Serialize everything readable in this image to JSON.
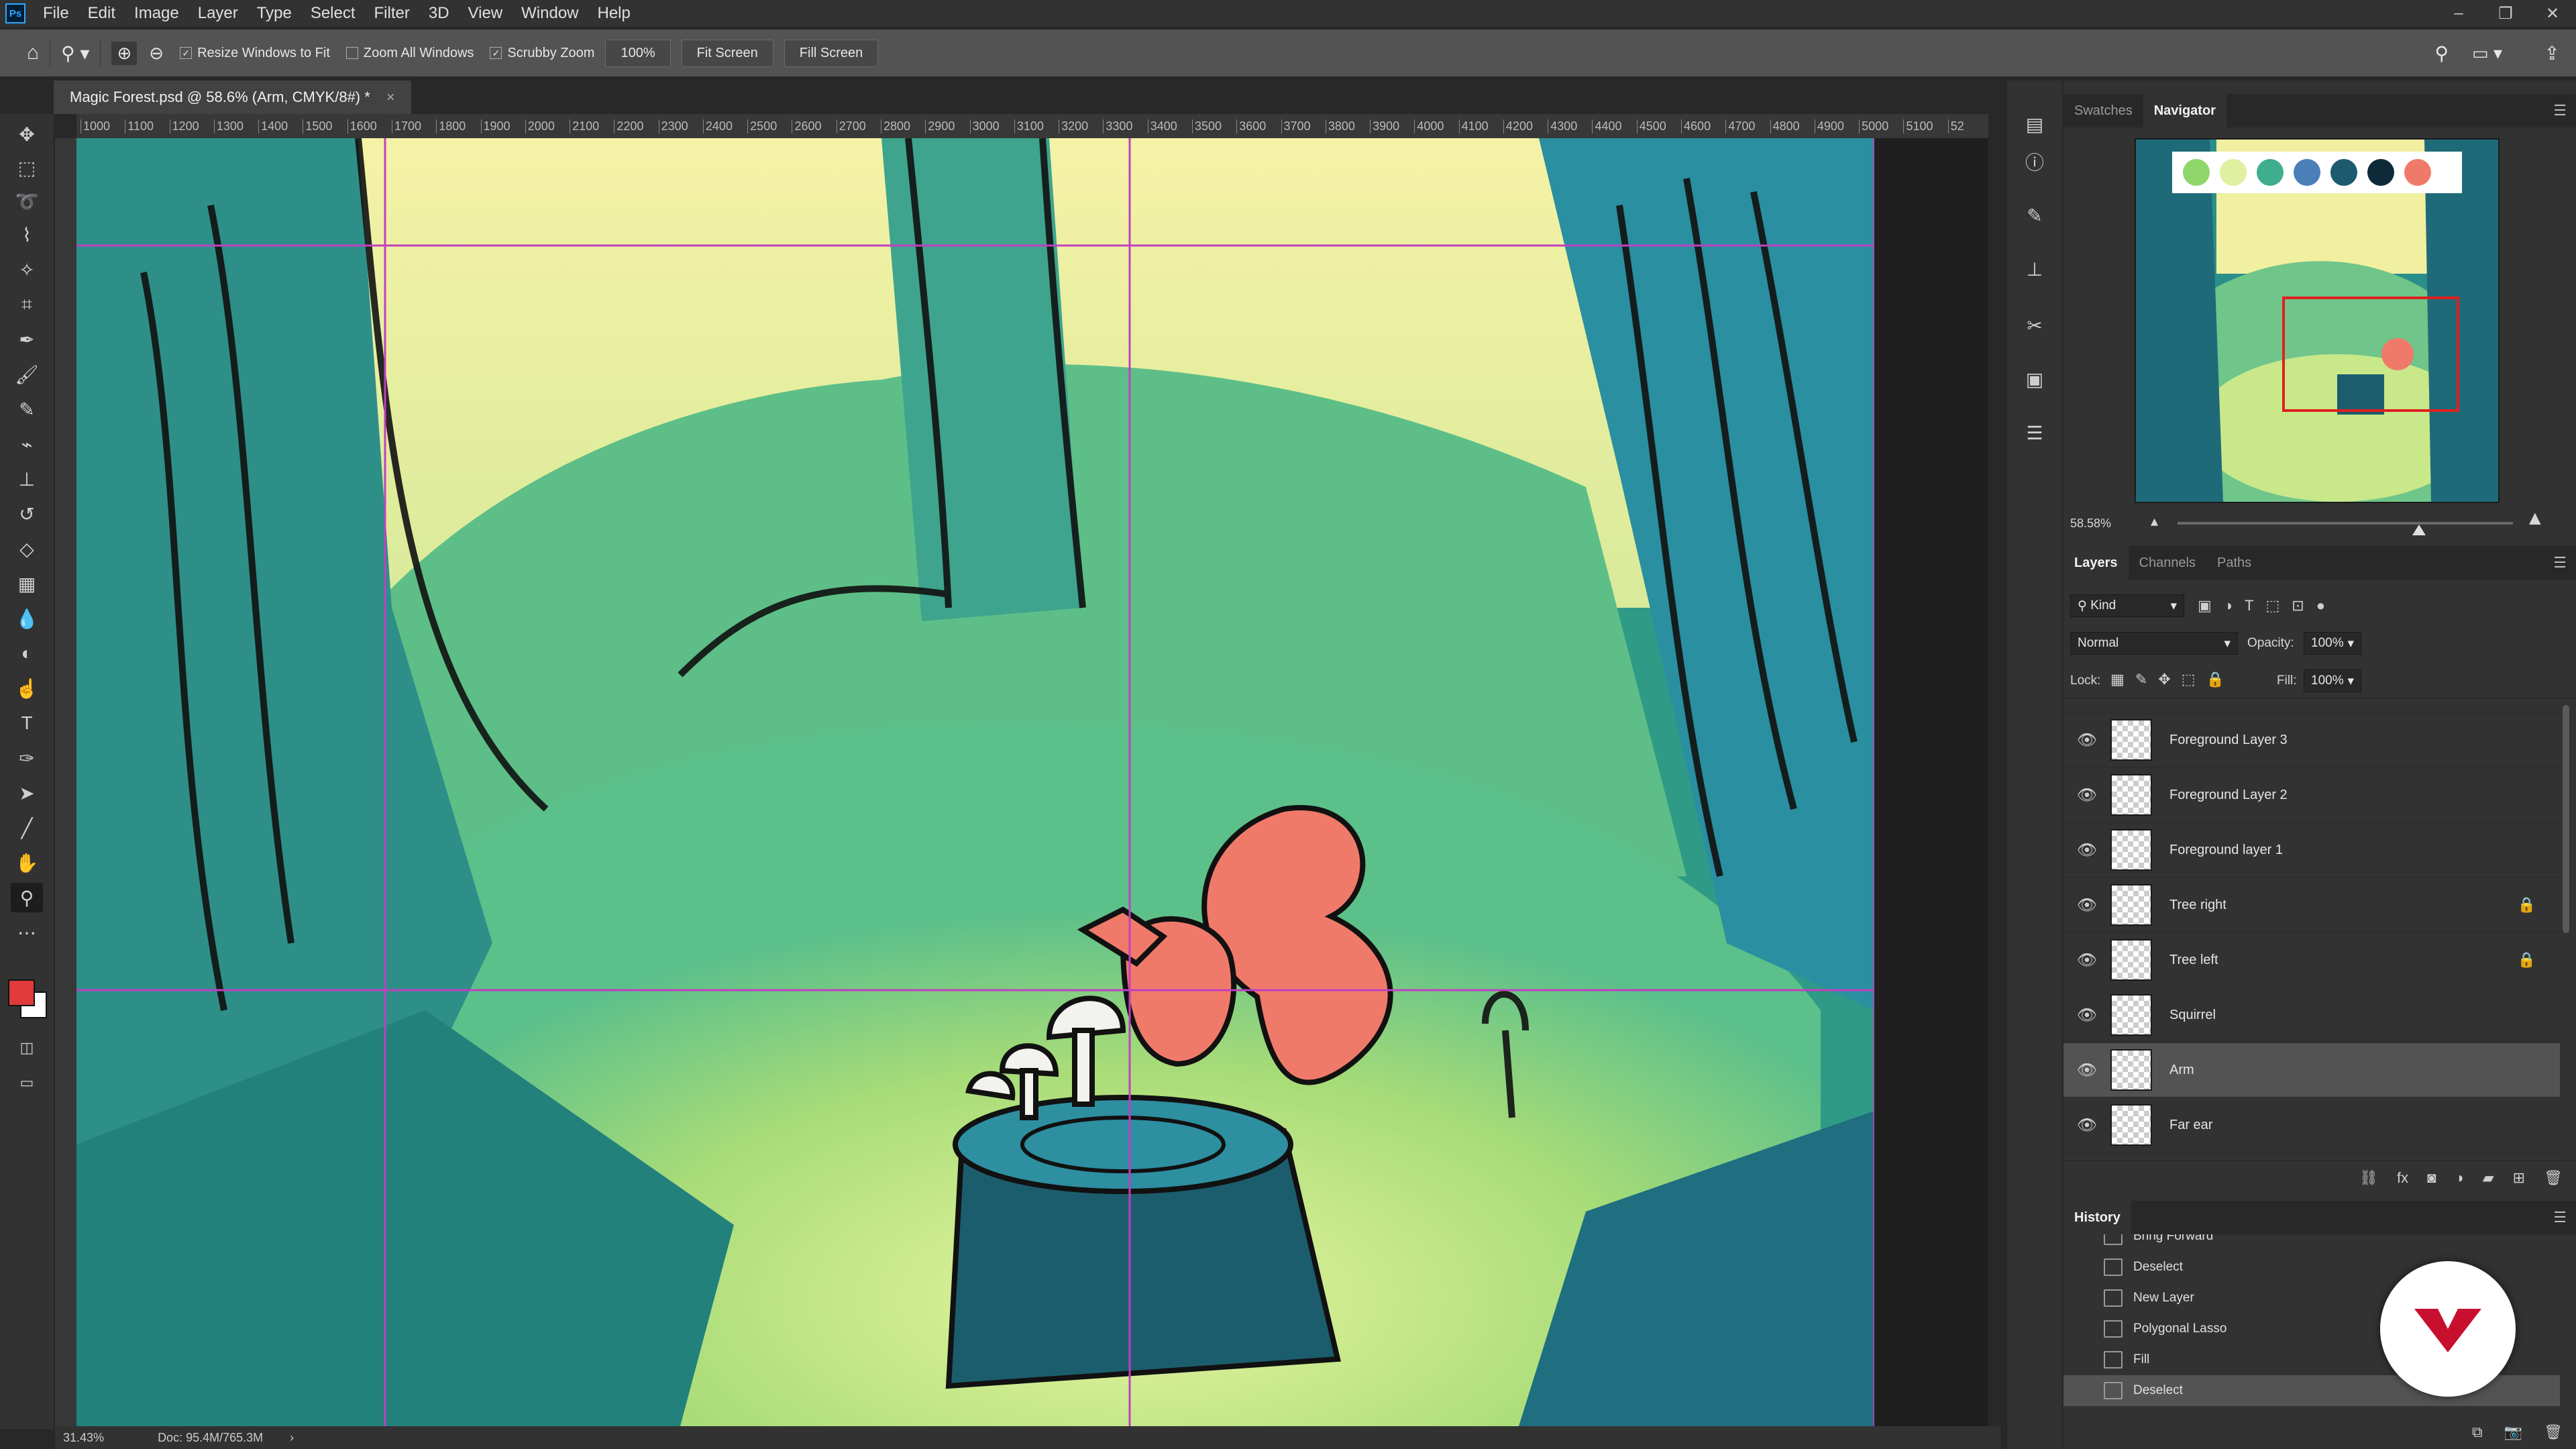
{
  "app": {
    "logo": "Ps"
  },
  "menu": [
    "File",
    "Edit",
    "Image",
    "Layer",
    "Type",
    "Select",
    "Filter",
    "3D",
    "View",
    "Window",
    "Help"
  ],
  "window_controls": [
    "minimize-icon",
    "restore-icon",
    "close-icon"
  ],
  "options": {
    "resize_windows": "Resize Windows to Fit",
    "zoom_all": "Zoom All Windows",
    "scrubby": "Scrubby Zoom",
    "zoom_value": "100%",
    "fit_screen": "Fit Screen",
    "fill_screen": "Fill Screen"
  },
  "document_tab": {
    "title": "Magic Forest.psd @ 58.6% (Arm, CMYK/8#) *",
    "close": "×"
  },
  "ruler_ticks": [
    "1000",
    "1100",
    "1200",
    "1300",
    "1400",
    "1500",
    "1600",
    "1700",
    "1800",
    "1900",
    "2000",
    "2100",
    "2200",
    "2300",
    "2400",
    "2500",
    "2600",
    "2700",
    "2800",
    "2900",
    "3000",
    "3100",
    "3200",
    "3300",
    "3400",
    "3500",
    "3600",
    "3700",
    "3800",
    "3900",
    "4000",
    "4100",
    "4200",
    "4300",
    "4400",
    "4500",
    "4600",
    "4700",
    "4800",
    "4900",
    "5000",
    "5100",
    "52"
  ],
  "tools": [
    "move-tool-icon",
    "marquee-tool-icon",
    "lasso-tool-icon",
    "polygonal-lasso-icon",
    "magic-wand-icon",
    "crop-tool-icon",
    "eyedropper-icon",
    "brush-tool-icon",
    "pencil-tool-icon",
    "mixer-brush-icon",
    "clone-stamp-icon",
    "history-brush-icon",
    "eraser-icon",
    "gradient-tool-icon",
    "blur-tool-icon",
    "dodge-tool-icon",
    "smudge-tool-icon",
    "type-tool-icon",
    "pen-tool-icon",
    "path-select-icon",
    "line-tool-icon",
    "hand-tool-icon",
    "zoom-tool-icon",
    "more-tools-icon"
  ],
  "colors": {
    "foreground": "#e03a3a",
    "background": "#ffffff",
    "accent": "#31a8ff",
    "badge": "#c8102e"
  },
  "navigator": {
    "tabs": [
      "Swatches",
      "Navigator"
    ],
    "active": "Navigator",
    "zoom": "58.58%",
    "swatches": [
      "#8fd66a",
      "#dff0a0",
      "#3fae8e",
      "#4a7fb8",
      "#1e5a6e",
      "#0e2a38",
      "#f07a6a"
    ],
    "zoom_level": 0.72
  },
  "layers_panel": {
    "tabs": [
      "Layers",
      "Channels",
      "Paths"
    ],
    "filter": "Kind",
    "blend_mode": "Normal",
    "opacity_label": "Opacity:",
    "opacity": "100%",
    "lock_label": "Lock:",
    "fill_label": "Fill:",
    "fill": "100%",
    "layers": [
      {
        "name": "Foreground Layer 3",
        "locked": false,
        "selected": false
      },
      {
        "name": "Foreground Layer 2",
        "locked": false,
        "selected": false
      },
      {
        "name": "Foreground layer 1",
        "locked": false,
        "selected": false
      },
      {
        "name": "Tree right",
        "locked": true,
        "selected": false
      },
      {
        "name": "Tree left",
        "locked": true,
        "selected": false
      },
      {
        "name": "Squirrel",
        "locked": false,
        "selected": false
      },
      {
        "name": "Arm",
        "locked": false,
        "selected": true
      },
      {
        "name": "Far ear",
        "locked": false,
        "selected": false
      }
    ]
  },
  "history": {
    "title": "History",
    "items": [
      "Bring Forward",
      "Deselect",
      "New Layer",
      "Polygonal Lasso",
      "Fill",
      "Deselect"
    ],
    "selected_index": 5
  },
  "status": {
    "zoom": "31.43%",
    "doc": "Doc: 95.4M/765.3M"
  }
}
